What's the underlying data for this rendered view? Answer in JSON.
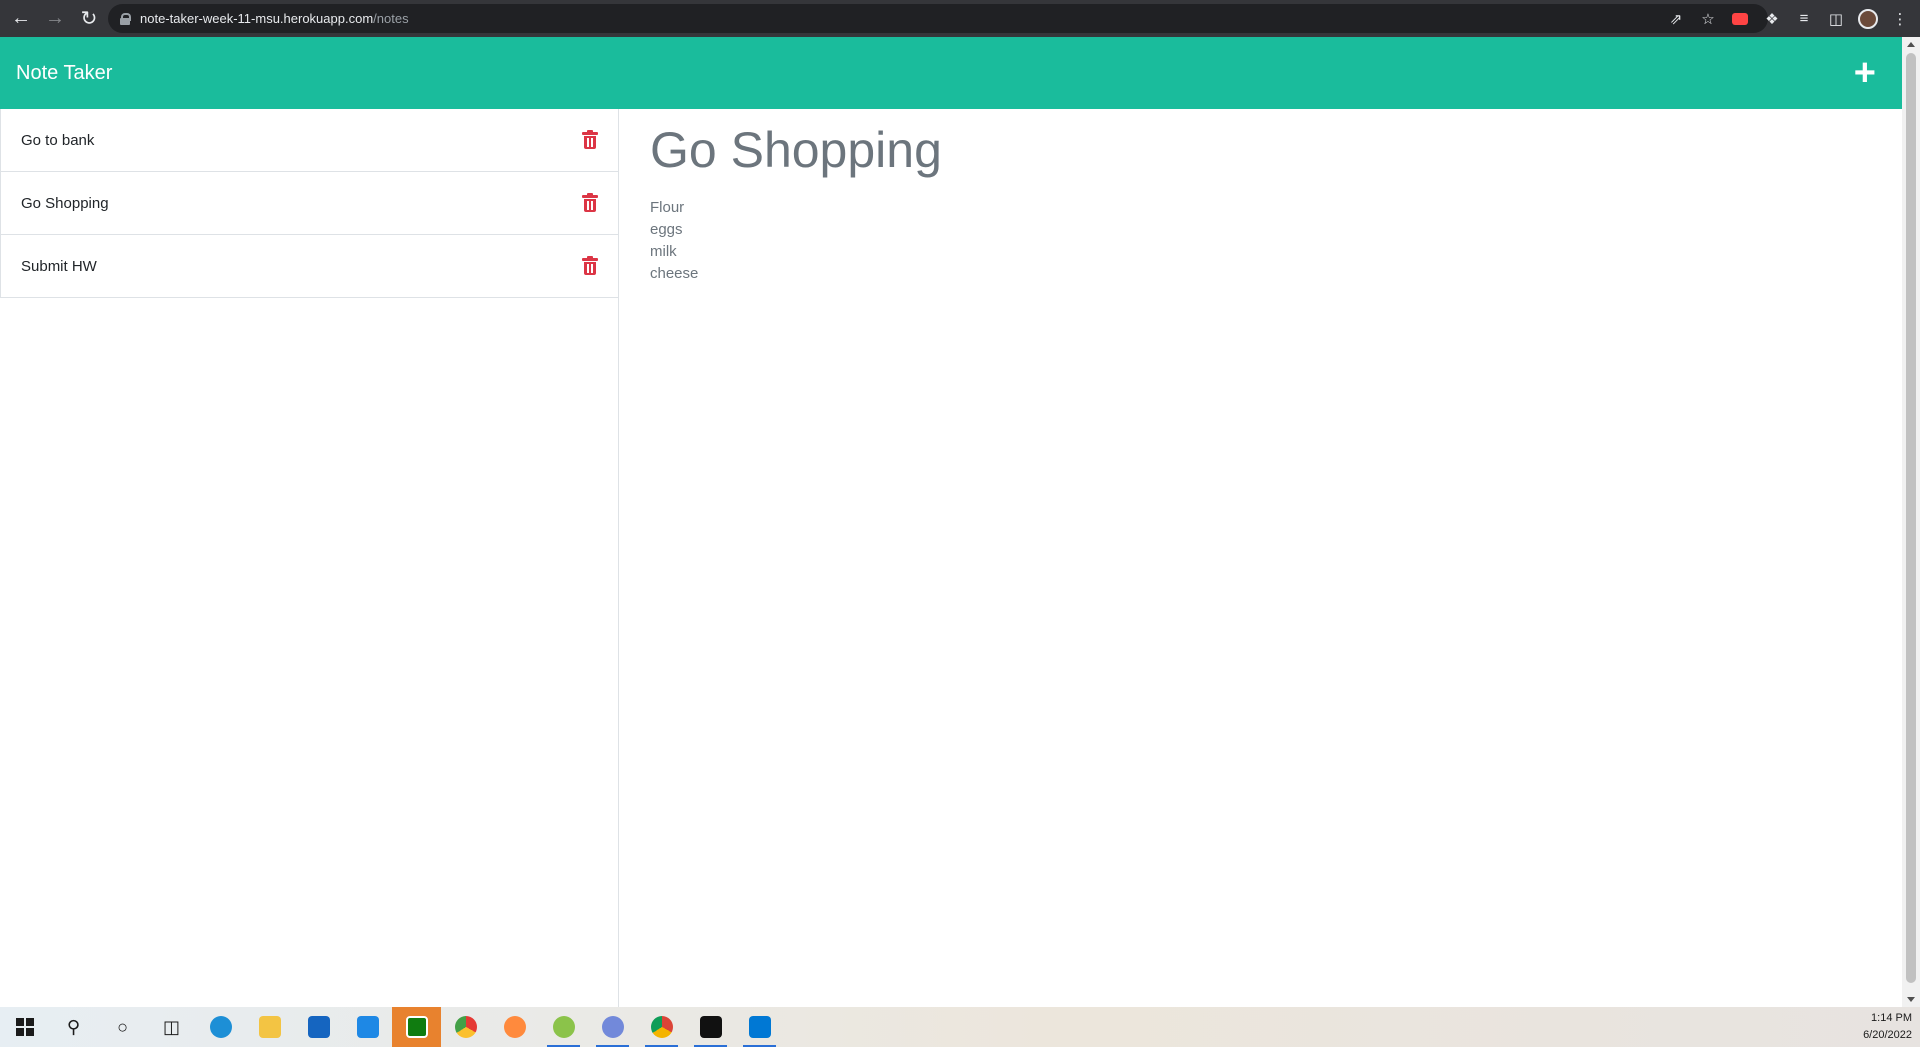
{
  "browser": {
    "url_host": "note-taker-week-11-msu.herokuapp.com",
    "url_path": "/notes"
  },
  "app": {
    "brand": "Note Taker",
    "new_note_icon": "plus-icon"
  },
  "notes": [
    {
      "title": "Go to bank",
      "delete_icon": "trash-icon"
    },
    {
      "title": "Go Shopping",
      "delete_icon": "trash-icon"
    },
    {
      "title": "Submit HW",
      "delete_icon": "trash-icon"
    }
  ],
  "active_note": {
    "title": "Go Shopping",
    "text": "Flour\neggs\nmilk\ncheese"
  },
  "taskbar": {
    "time": "1:14 PM",
    "date": "6/20/2022",
    "apps": [
      "start-icon",
      "search-icon",
      "cortana-icon",
      "task-view-icon",
      "edge-icon",
      "file-explorer-icon",
      "store-icon",
      "mail-icon",
      "xbox-icon",
      "chrome-canary-icon",
      "swirl-app-icon",
      "w-app-icon",
      "discord-icon",
      "chrome-icon",
      "terminal-icon",
      "vscode-icon"
    ]
  },
  "colors": {
    "accent": "#1abc9c",
    "delete": "#dc3545",
    "text_muted": "#6c757d"
  }
}
